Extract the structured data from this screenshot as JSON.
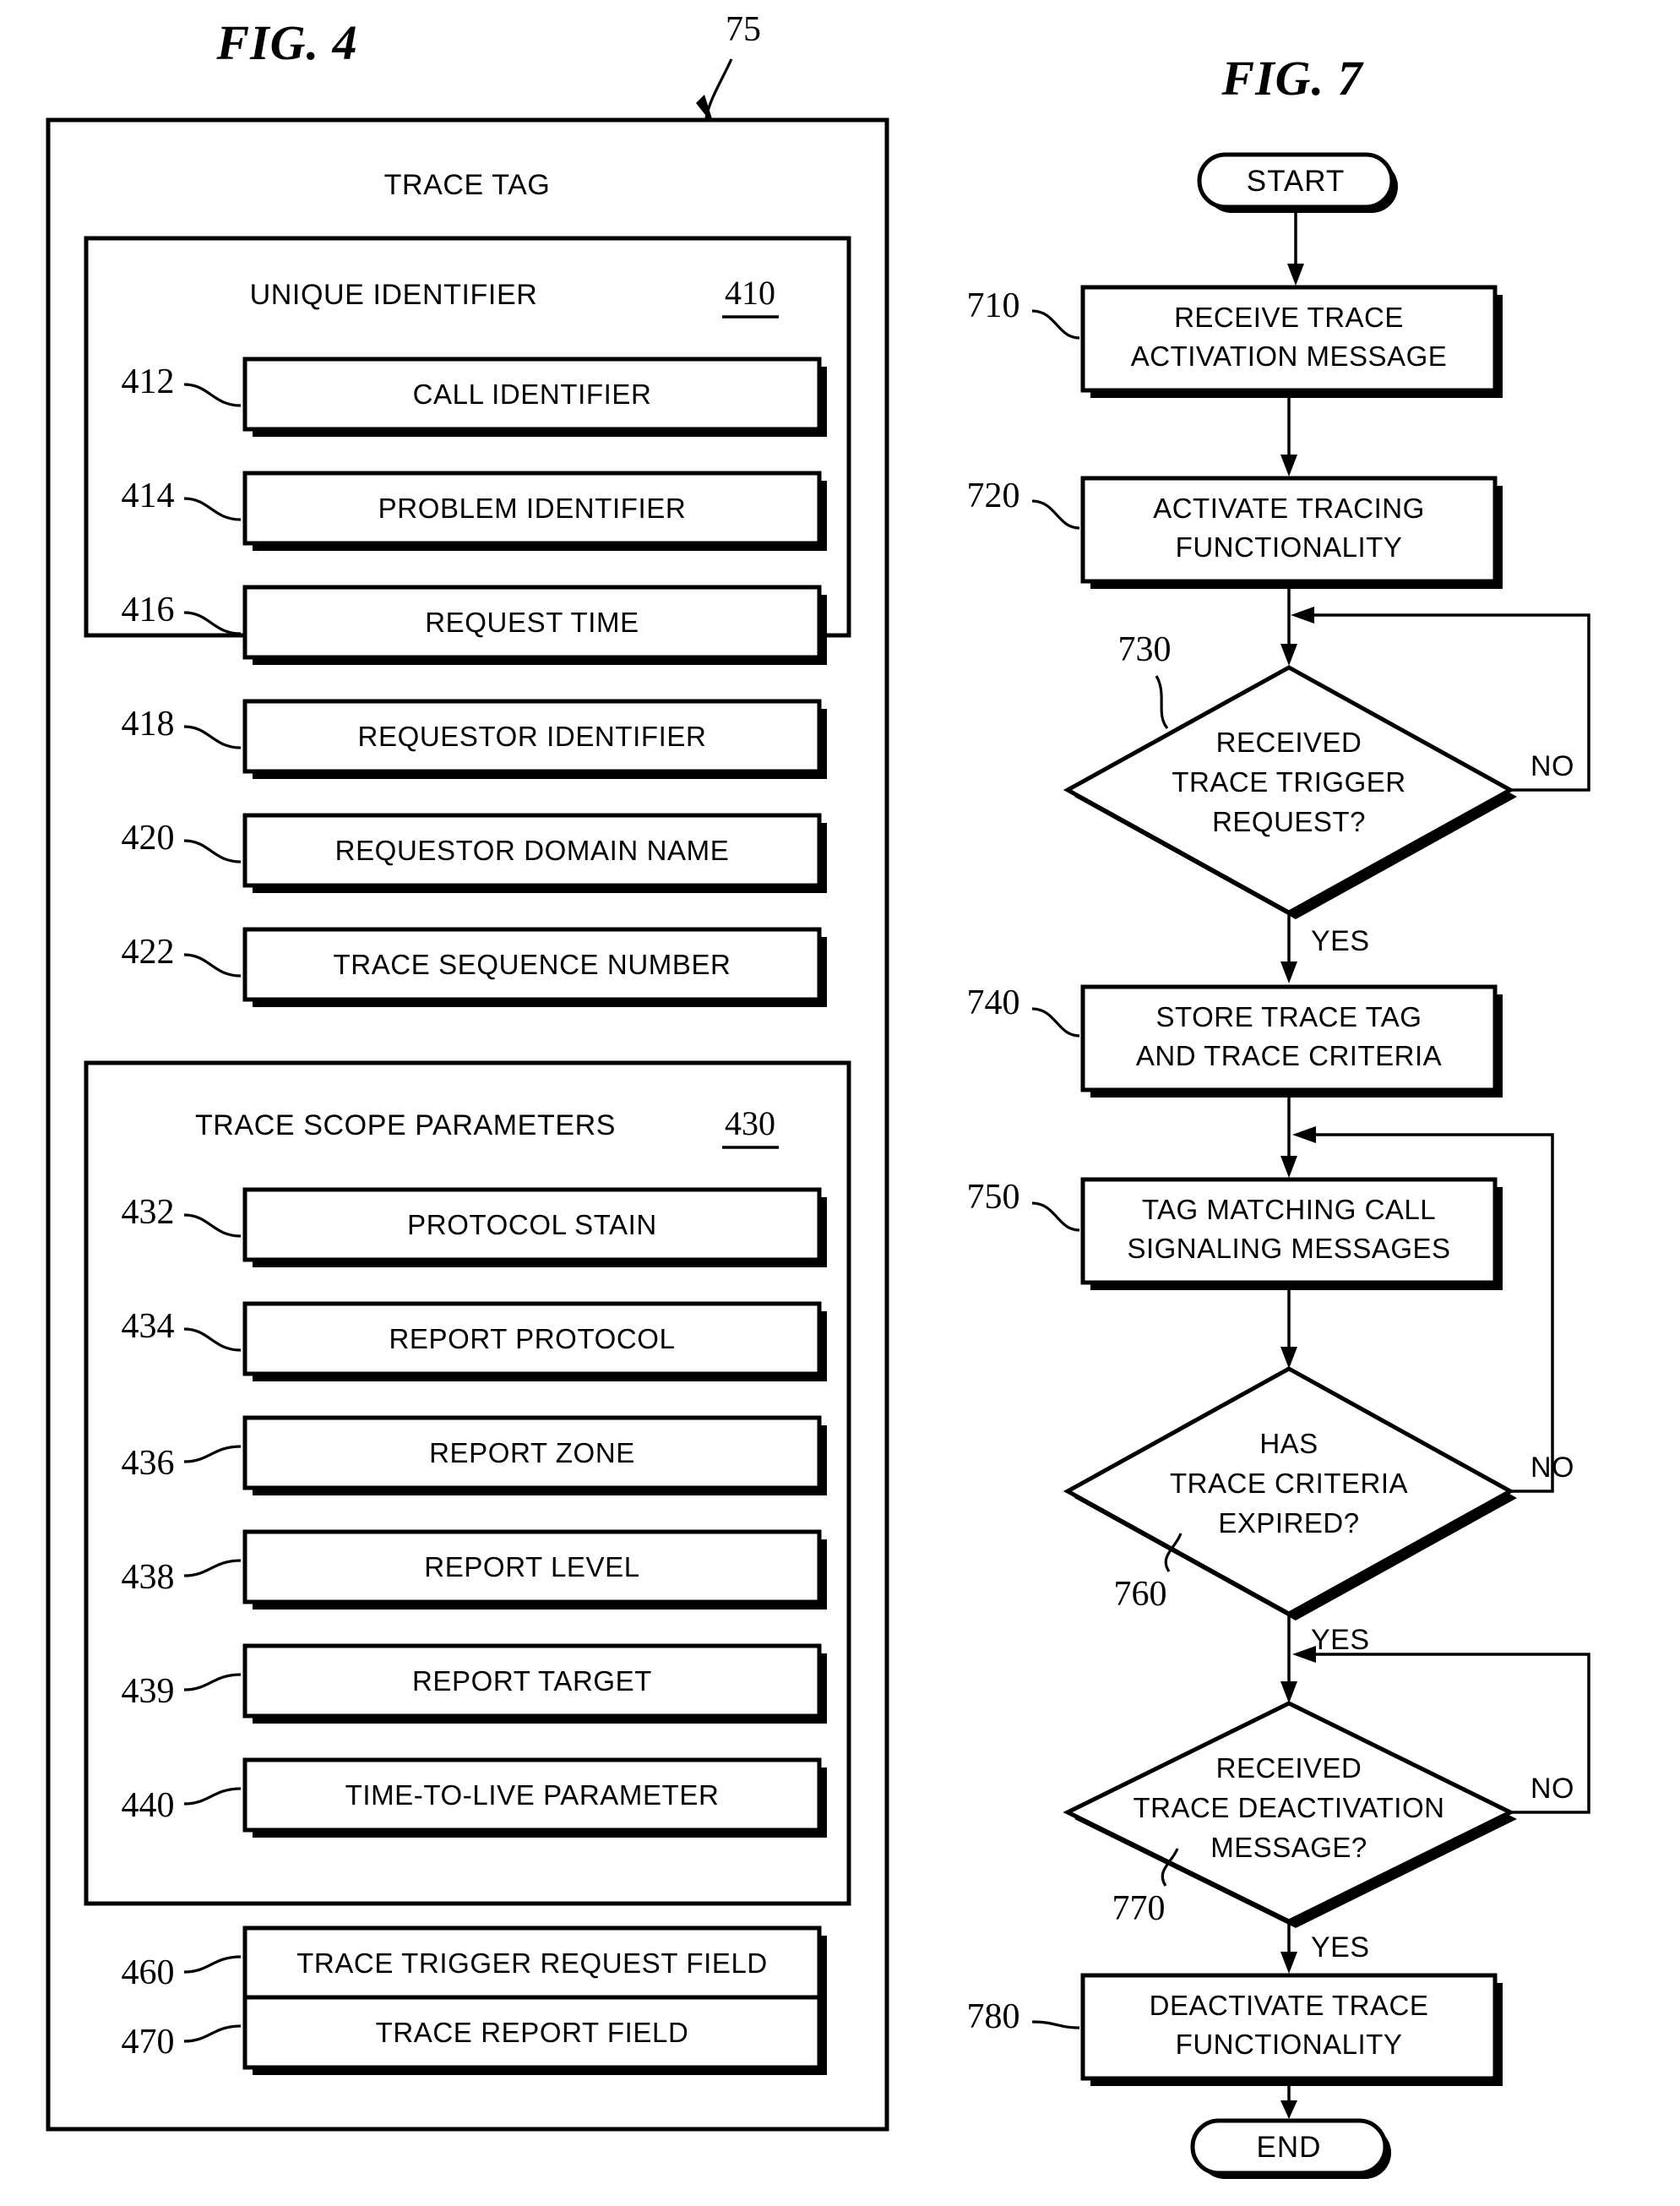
{
  "figures": [
    {
      "id": "fig4",
      "title": "FIG. 4",
      "outer_ref": "75",
      "outer_title": "TRACE TAG",
      "sections": [
        {
          "heading": "UNIQUE IDENTIFIER",
          "ref": "410",
          "rows": [
            {
              "ref": "412",
              "label": "CALL IDENTIFIER"
            },
            {
              "ref": "414",
              "label": "PROBLEM IDENTIFIER"
            },
            {
              "ref": "416",
              "label": "REQUEST TIME"
            },
            {
              "ref": "418",
              "label": "REQUESTOR IDENTIFIER"
            },
            {
              "ref": "420",
              "label": "REQUESTOR DOMAIN NAME"
            },
            {
              "ref": "422",
              "label": "TRACE SEQUENCE NUMBER"
            }
          ]
        },
        {
          "heading": "TRACE SCOPE PARAMETERS",
          "ref": "430",
          "rows": [
            {
              "ref": "432",
              "label": "PROTOCOL STAIN"
            },
            {
              "ref": "434",
              "label": "REPORT PROTOCOL"
            },
            {
              "ref": "436",
              "label": "REPORT ZONE"
            },
            {
              "ref": "438",
              "label": "REPORT LEVEL"
            },
            {
              "ref": "439",
              "label": "REPORT TARGET"
            },
            {
              "ref": "440",
              "label": "TIME-TO-LIVE PARAMETER"
            }
          ]
        }
      ],
      "loose_rows": [
        {
          "ref": "460",
          "label": "TRACE TRIGGER REQUEST FIELD"
        },
        {
          "ref": "470",
          "label": "TRACE REPORT FIELD"
        }
      ]
    },
    {
      "id": "fig7",
      "title": "FIG. 7",
      "start_label": "START",
      "end_label": "END",
      "nodes": [
        {
          "ref": "710",
          "type": "process",
          "lines": [
            "RECEIVE TRACE",
            "ACTIVATION MESSAGE"
          ]
        },
        {
          "ref": "720",
          "type": "process",
          "lines": [
            "ACTIVATE TRACING",
            "FUNCTIONALITY"
          ]
        },
        {
          "ref": "730",
          "type": "decision",
          "lines": [
            "RECEIVED",
            "TRACE TRIGGER",
            "REQUEST?"
          ],
          "yes": "YES",
          "no": "NO"
        },
        {
          "ref": "740",
          "type": "process",
          "lines": [
            "STORE TRACE TAG",
            "AND TRACE CRITERIA"
          ]
        },
        {
          "ref": "750",
          "type": "process",
          "lines": [
            "TAG MATCHING CALL",
            "SIGNALING MESSAGES"
          ]
        },
        {
          "ref": "760",
          "type": "decision",
          "lines": [
            "HAS",
            "TRACE CRITERIA",
            "EXPIRED?"
          ],
          "yes": "YES",
          "no": "NO"
        },
        {
          "ref": "770",
          "type": "decision",
          "lines": [
            "RECEIVED",
            "TRACE DEACTIVATION",
            "MESSAGE?"
          ],
          "yes": "YES",
          "no": "NO"
        },
        {
          "ref": "780",
          "type": "process",
          "lines": [
            "DEACTIVATE TRACE",
            "FUNCTIONALITY"
          ]
        }
      ]
    }
  ],
  "colors": {
    "ink": "#000000",
    "paper": "#ffffff"
  }
}
